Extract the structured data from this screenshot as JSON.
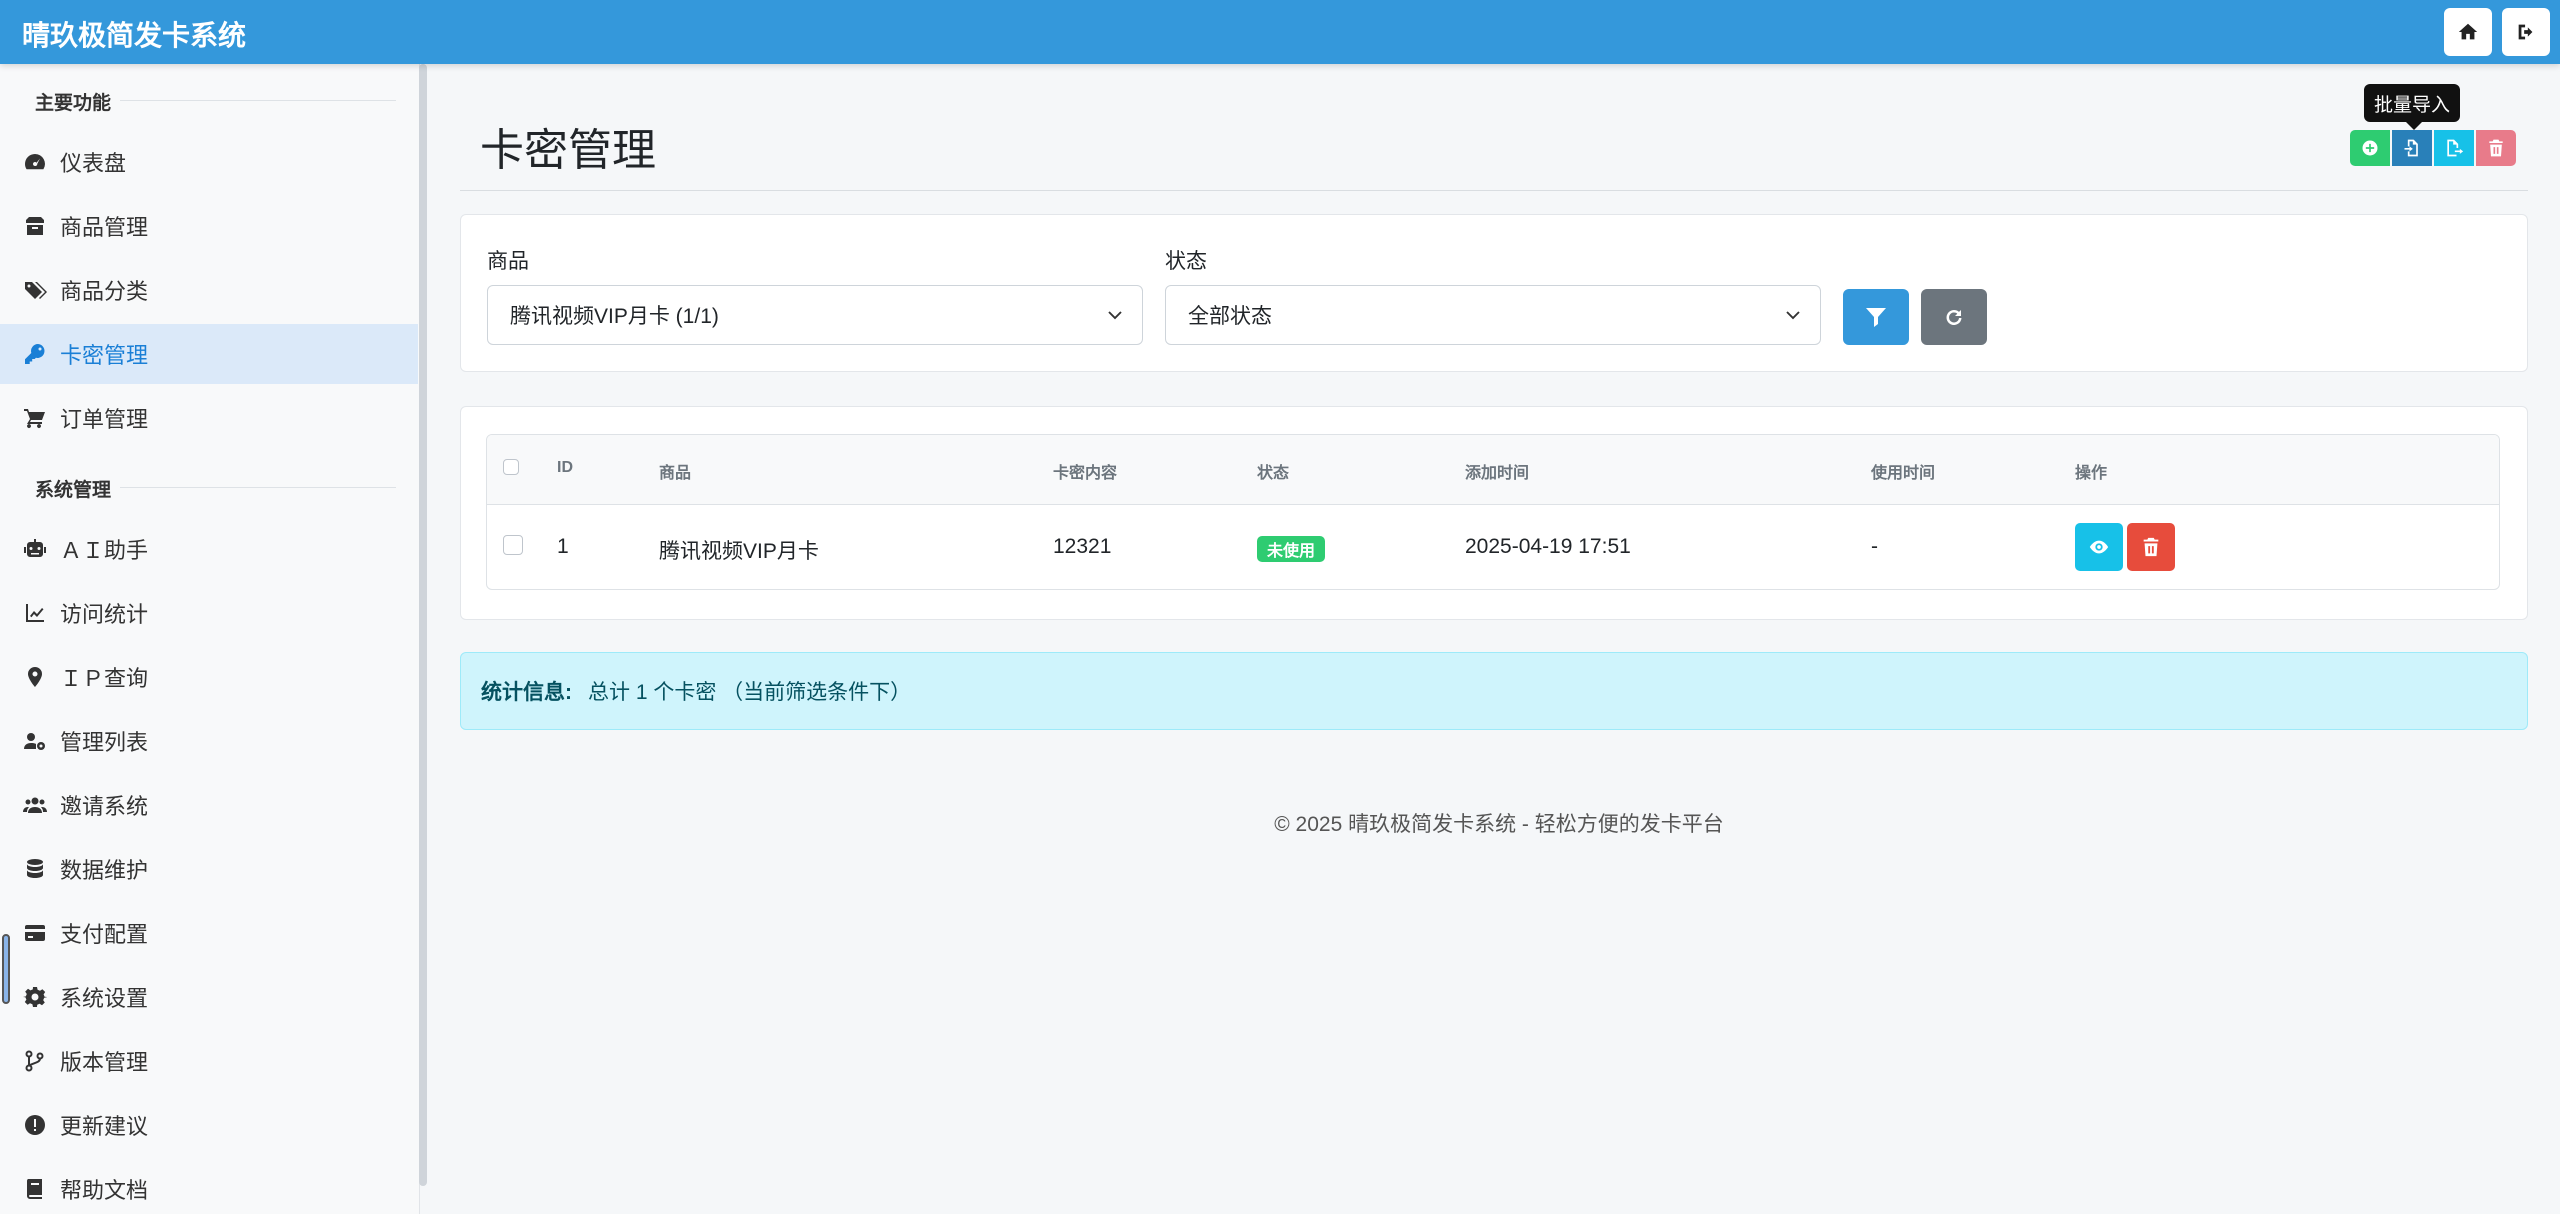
{
  "app": {
    "brand": "晴玖极简发卡系统"
  },
  "header_buttons": [
    {
      "name": "home",
      "icon": "home-icon"
    },
    {
      "name": "logout",
      "icon": "logout-icon"
    }
  ],
  "sidebar": {
    "sections": [
      {
        "title": "主要功能"
      },
      {
        "title": "系统管理"
      }
    ],
    "main_items": [
      {
        "label": "仪表盘",
        "icon": "dashboard-icon"
      },
      {
        "label": "商品管理",
        "icon": "box-icon"
      },
      {
        "label": "商品分类",
        "icon": "tags-icon"
      },
      {
        "label": "卡密管理",
        "icon": "key-icon",
        "active": true
      },
      {
        "label": "订单管理",
        "icon": "cart-icon"
      }
    ],
    "system_items": [
      {
        "label": "ＡＩ助手",
        "icon": "robot-icon"
      },
      {
        "label": "访问统计",
        "icon": "chart-line-icon"
      },
      {
        "label": "ＩＰ查询",
        "icon": "map-pin-icon"
      },
      {
        "label": "管理列表",
        "icon": "users-cog-icon"
      },
      {
        "label": "邀请系统",
        "icon": "users-icon"
      },
      {
        "label": "数据维护",
        "icon": "database-icon"
      },
      {
        "label": "支付配置",
        "icon": "credit-card-icon"
      },
      {
        "label": "系统设置",
        "icon": "gear-icon"
      },
      {
        "label": "版本管理",
        "icon": "branch-icon"
      },
      {
        "label": "更新建议",
        "icon": "exclamation-icon"
      },
      {
        "label": "帮助文档",
        "icon": "book-icon"
      }
    ]
  },
  "main": {
    "title": "卡密管理",
    "tooltip": "批量导入",
    "action_colors": {
      "add": "#2ecc71",
      "import": "#2980b9",
      "export": "#17c1e8",
      "delete": "#e87b8a"
    },
    "filters": {
      "product_label": "商品",
      "product_value": "腾讯视频VIP月卡 (1/1)",
      "status_label": "状态",
      "status_value": "全部状态"
    },
    "table": {
      "headers": [
        "ID",
        "商品",
        "卡密内容",
        "状态",
        "添加时间",
        "使用时间",
        "操作"
      ],
      "rows": [
        {
          "id": "1",
          "product": "腾讯视频VIP月卡",
          "content": "12321",
          "status": "未使用",
          "added": "2025-04-19 17:51",
          "used": "-"
        }
      ]
    },
    "stats": {
      "label": "统计信息:",
      "text": "总计 1 个卡密 （当前筛选条件下）"
    },
    "footer": "© 2025 晴玖极简发卡系统 - 轻松方便的发卡平台"
  }
}
